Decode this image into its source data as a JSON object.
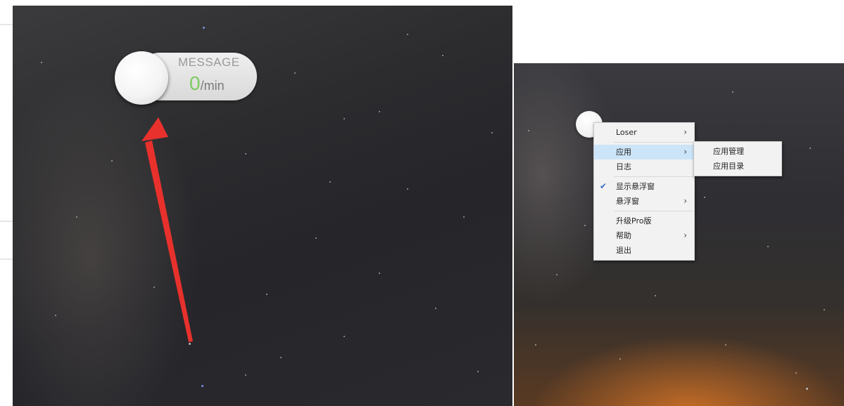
{
  "widget": {
    "title": "MESSAGE",
    "rate_value": "0",
    "rate_unit": "/min",
    "rate_color": "#7fcc62"
  },
  "annotation": {
    "arrow_color": "#e8312c"
  },
  "context_menu": {
    "items": [
      {
        "label": "Loser",
        "submenu": true
      },
      {
        "label": "应用",
        "submenu": true,
        "highlighted": true
      },
      {
        "label": "日志"
      },
      {
        "label": "显示悬浮窗",
        "checked": true
      },
      {
        "label": "悬浮窗",
        "submenu": true
      },
      {
        "label": "升级Pro版"
      },
      {
        "label": "帮助",
        "submenu": true
      },
      {
        "label": "退出"
      }
    ],
    "chevron": "›",
    "checkmark": "✔"
  },
  "submenu": {
    "items": [
      {
        "label": "应用管理"
      },
      {
        "label": "应用目录"
      }
    ]
  },
  "colors": {
    "menu_bg": "#f2f2f2",
    "menu_highlight": "#cce4f7"
  }
}
